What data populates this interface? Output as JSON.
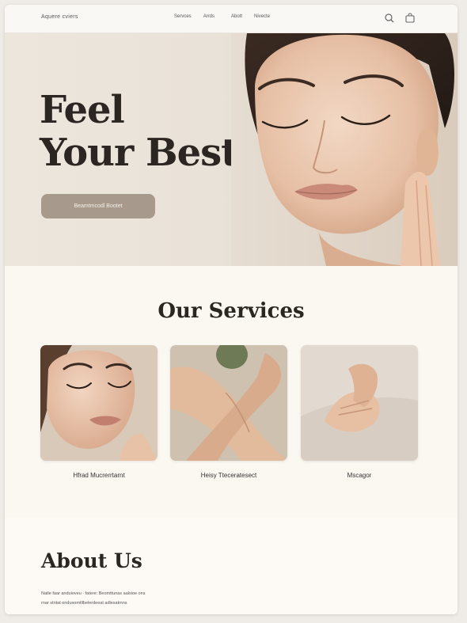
{
  "header": {
    "brand": "Aquere cviers",
    "nav": [
      "Servces",
      "Arrds",
      "Abott",
      "Nivecte"
    ],
    "icons": [
      "search-icon",
      "cart-icon"
    ]
  },
  "hero": {
    "title_line1": "Feel",
    "title_line2": "Your Best",
    "cta_label": "Beamtmcodl Bootet"
  },
  "services": {
    "title": "Our Services",
    "cards": [
      {
        "label": "Hfrad Mucrerrtarnt"
      },
      {
        "label": "Heisy Tteceratesect"
      },
      {
        "label": "Mscagor"
      }
    ]
  },
  "about": {
    "title": "About Us",
    "lines": [
      "Natle faar anduioveu · fatere: Beomttunas aalsioe ons",
      "rnar stntat ondusomtllbelerdeeat adlesatmns"
    ]
  },
  "colors": {
    "page_bg": "#fbf8f3",
    "hero_bg": "#ece6dd",
    "cta_bg": "#a79a8c",
    "text_dark": "#2b2622"
  }
}
